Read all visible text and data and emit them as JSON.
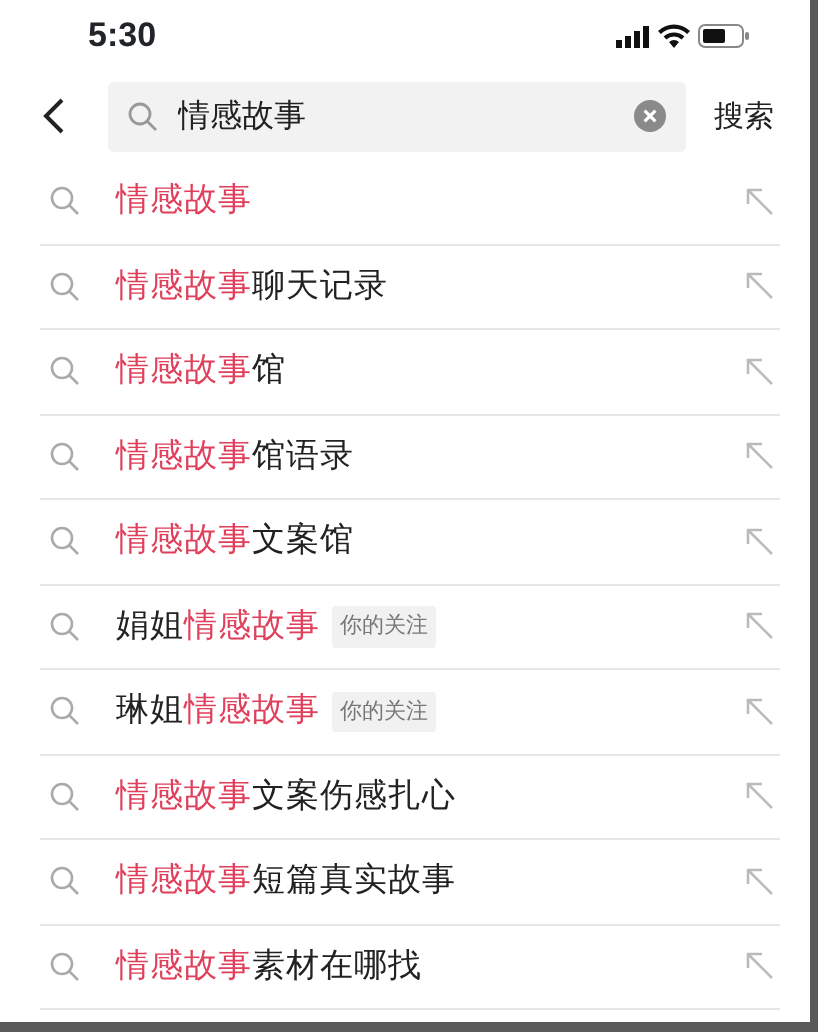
{
  "status_bar": {
    "time": "5:30"
  },
  "search": {
    "value": "情感故事",
    "submit": "搜索"
  },
  "suggestions": [
    {
      "match": "情感故事"
    },
    {
      "match": "情感故事",
      "suffix": "聊天记录"
    },
    {
      "match": "情感故事",
      "suffix": "馆"
    },
    {
      "match": "情感故事",
      "suffix": "馆语录"
    },
    {
      "match": "情感故事",
      "suffix": "文案馆"
    },
    {
      "prefix": "娟姐",
      "match": "情感故事",
      "tag": "你的关注"
    },
    {
      "prefix": "琳姐",
      "match": "情感故事",
      "tag": "你的关注"
    },
    {
      "match": "情感故事",
      "suffix": "文案伤感扎心"
    },
    {
      "match": "情感故事",
      "suffix": "短篇真实故事"
    },
    {
      "match": "情感故事",
      "suffix": "素材在哪找"
    }
  ]
}
